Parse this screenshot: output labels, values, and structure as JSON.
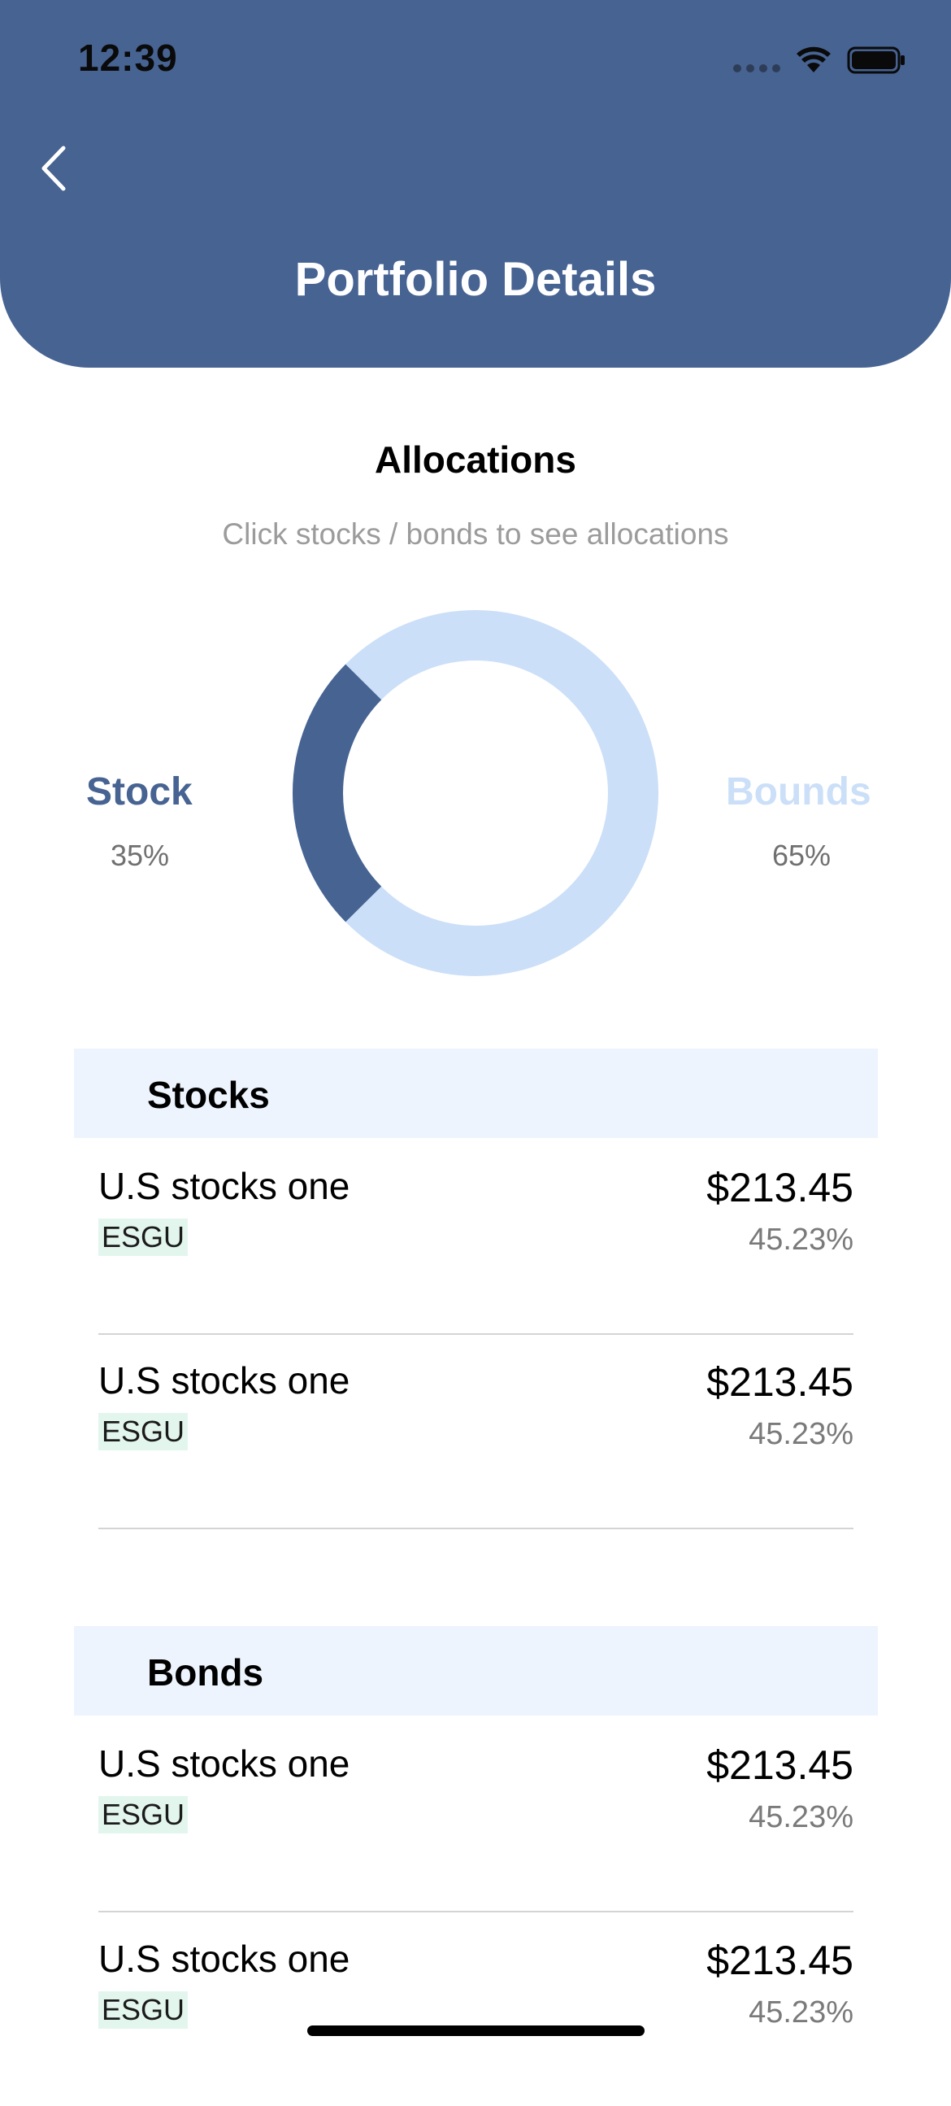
{
  "status": {
    "time": "12:39"
  },
  "header": {
    "title": "Portfolio Details"
  },
  "allocations": {
    "title": "Allocations",
    "subtitle": "Click stocks / bonds to see allocations",
    "stock_label": "Stock",
    "stock_pct": "35%",
    "bonds_label": "Bounds",
    "bonds_pct": "65%",
    "stock_color": "#466392",
    "bonds_color": "#cbdff8"
  },
  "sections": [
    {
      "title": "Stocks",
      "items": [
        {
          "name": "U.S stocks one",
          "ticker": "ESGU",
          "price": "$213.45",
          "pct": "45.23%"
        },
        {
          "name": "U.S stocks one",
          "ticker": "ESGU",
          "price": "$213.45",
          "pct": "45.23%"
        }
      ]
    },
    {
      "title": "Bonds",
      "items": [
        {
          "name": "U.S stocks one",
          "ticker": "ESGU",
          "price": "$213.45",
          "pct": "45.23%"
        },
        {
          "name": "U.S stocks one",
          "ticker": "ESGU",
          "price": "$213.45",
          "pct": "45.23%"
        }
      ]
    }
  ],
  "colors": {
    "header": "#466392",
    "section_bg": "#eef4fd",
    "ticker_bg": "#e3f6ee"
  }
}
